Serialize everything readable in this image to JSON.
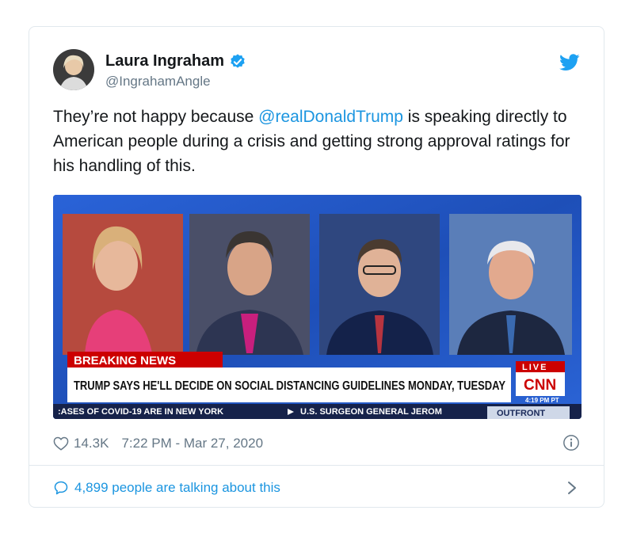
{
  "tweet": {
    "author_name": "Laura Ingraham",
    "author_handle": "@IngrahamAngle",
    "text_before": "They’re not happy because ",
    "mention": "@realDonaldTrump",
    "text_after": " is speaking directly to American people during a crisis and getting strong approval ratings for his handling of this.",
    "likes": "14.3K",
    "timestamp": "7:22 PM - Mar 27, 2020",
    "talking": "4,899 people are talking about this"
  },
  "media": {
    "breaking_label": "BREAKING NEWS",
    "headline": "TRUMP SAYS HE'LL DECIDE ON SOCIAL DISTANCING GUIDELINES MONDAY, TUESDAY",
    "live_label": "LIVE",
    "network": "CNN",
    "clock": "4:19 PM PT",
    "ticker_left": ":ASES OF COVID-19 ARE IN NEW YORK",
    "ticker_right": "U.S. SURGEON GENERAL JEROM",
    "show_name": "OUTFRONT"
  },
  "colors": {
    "link_blue": "#1b95e0",
    "verified_blue": "#1da1f2",
    "muted_gray": "#657786",
    "breaking_red": "#cc0000"
  },
  "icons": {
    "verified": "verified-badge-icon",
    "brand": "twitter-bird-icon",
    "like": "heart-icon",
    "info": "info-icon",
    "talking": "speech-bubble-icon",
    "more": "chevron-right-icon"
  }
}
